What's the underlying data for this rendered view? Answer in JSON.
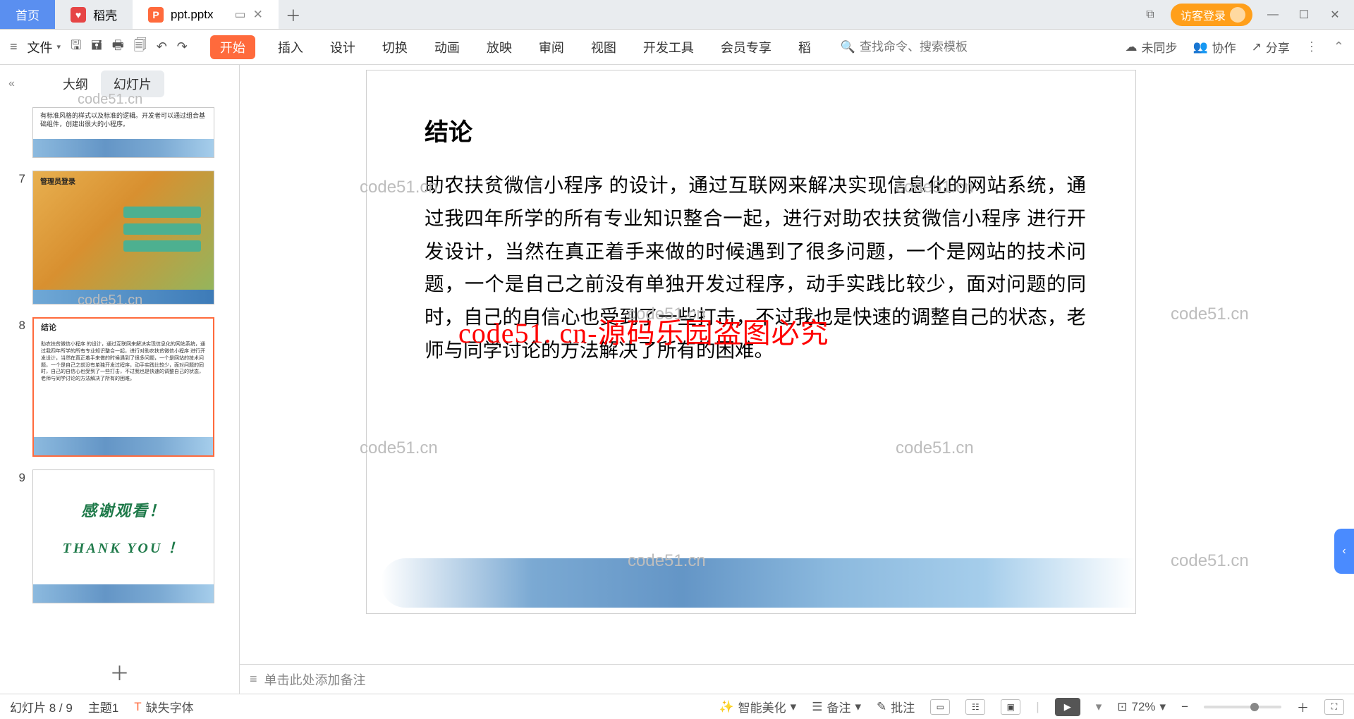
{
  "titlebar": {
    "tabs": [
      {
        "label": "首页",
        "type": "home"
      },
      {
        "label": "稻壳",
        "type": "dk"
      },
      {
        "label": "ppt.pptx",
        "type": "doc"
      }
    ],
    "login": "访客登录"
  },
  "ribbon": {
    "file": "文件",
    "tabs": [
      "开始",
      "插入",
      "设计",
      "切换",
      "动画",
      "放映",
      "审阅",
      "视图",
      "开发工具",
      "会员专享",
      "稻"
    ],
    "search_placeholder": "查找命令、搜索模板",
    "unsync": "未同步",
    "collab": "协作",
    "share": "分享"
  },
  "sidebar": {
    "outline": "大纲",
    "slides": "幻灯片",
    "thumb7_title": "管理员登录",
    "thumb8_title": "结论",
    "thumb9_line1": "感谢观看！",
    "thumb9_line2": "THANK   YOU ！",
    "nums": {
      "n7": "7",
      "n8": "8",
      "n9": "9"
    }
  },
  "slide": {
    "title": "结论",
    "body": "助农扶贫微信小程序 的设计，通过互联网来解决实现信息化的网站系统，通过我四年所学的所有专业知识整合一起，进行对助农扶贫微信小程序 进行开发设计，当然在真正着手来做的时候遇到了很多问题，一个是网站的技术问题，一个是自己之前没有单独开发过程序，动手实践比较少，面对问题的同时，自己的自信心也受到了一些打击，不过我也是快速的调整自己的状态，老师与同学讨论的方法解决了所有的困难。",
    "overlay": "code51. cn-源码乐园盗图必究"
  },
  "notes_placeholder": "单击此处添加备注",
  "status": {
    "slide": "幻灯片 8 / 9",
    "theme": "主题1",
    "missing_font": "缺失字体",
    "beautify": "智能美化",
    "notes": "备注",
    "comment": "批注",
    "zoom": "72%"
  },
  "watermark": "code51.cn"
}
